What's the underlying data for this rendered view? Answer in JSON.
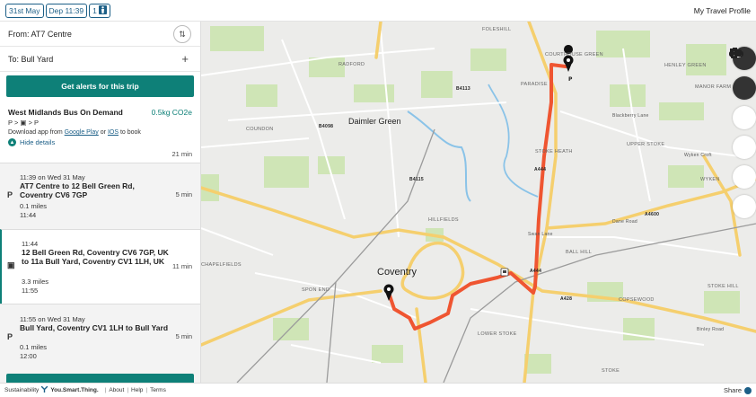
{
  "header": {
    "date_label": "31st May",
    "depart_label": "Dep 11:39",
    "passengers": "1",
    "profile_label": "My Travel Profile"
  },
  "trip": {
    "from_label": "From: AT7 Centre",
    "to_label": "To: Bull Yard",
    "alerts_button": "Get alerts for this trip"
  },
  "summary": {
    "operator": "West Midlands Bus On Demand",
    "co2": "0.5kg CO2e",
    "modes": "P > ▣ > P",
    "download_prefix": "Download app from",
    "google_play": "Google Play",
    "or": "or",
    "ios": "IOS",
    "download_suffix": "to book",
    "hide_details": "Hide details",
    "duration": "21 min"
  },
  "legs": [
    {
      "icon": "P",
      "time": "11:39 on Wed 31 May",
      "name": "AT7 Centre to 12 Bell Green Rd, Coventry CV6 7GP",
      "distance": "0.1 miles",
      "end_time": "11:44",
      "duration": "5 min"
    },
    {
      "icon": "▣",
      "time": "11:44",
      "name": "12 Bell Green Rd, Coventry CV6 7GP, UK to 11a Bull Yard, Coventry CV1 1LH, UK",
      "distance": "3.3 miles",
      "end_time": "11:55",
      "duration": "11 min"
    },
    {
      "icon": "P",
      "time": "11:55 on Wed 31 May",
      "name": "Bull Yard, Coventry CV1 1LH to Bull Yard",
      "distance": "0.1 miles",
      "end_time": "12:00",
      "duration": "5 min"
    }
  ],
  "map": {
    "places": {
      "foleshill": "FOLESHILL",
      "courthouse_green": "COURTHOUSE GREEN",
      "henley_green": "HENLEY GREEN",
      "radford": "RADFORD",
      "paradise": "PARADISE",
      "manor_farm": "MANOR FARM ESTATE",
      "daimler_green": "Daimler Green",
      "coundon": "COUNDON",
      "stoke_heath": "STOKE HEATH",
      "upper_stoke": "UPPER STOKE",
      "wyken": "WYKEN",
      "hillfields": "HILLFIELDS",
      "coventry": "Coventry",
      "ball_hill": "BALL HILL",
      "chapelfields": "CHAPELFIELDS",
      "spon_end": "SPON END",
      "copsewood": "COPSEWOOD",
      "stoke_hill": "STOKE HILL",
      "lower_stoke": "LOWER STOKE",
      "stoke": "STOKE"
    },
    "roads": {
      "b4113": "B4113",
      "b4098": "B4098",
      "b4115": "B4115",
      "a444": "A444",
      "a4600": "A4600",
      "a428": "A428",
      "blackberry_lane": "Blackberry Lane",
      "dane_road": "Dane Road",
      "binley_road": "Binley Road",
      "swan_lane": "Swan Lane",
      "wyken_croft": "Wyken Croft"
    },
    "route_color": "#ef5531"
  },
  "footer": {
    "sustainability": "Sustainability",
    "brand": "You.Smart.Thing.",
    "about": "About",
    "help": "Help",
    "terms": "Terms",
    "share": "Share"
  }
}
